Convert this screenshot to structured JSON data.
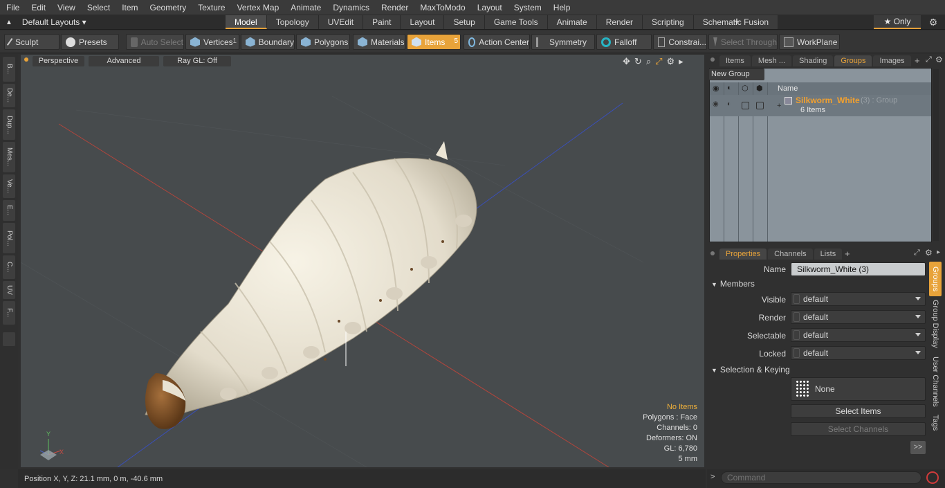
{
  "menu": [
    "File",
    "Edit",
    "View",
    "Select",
    "Item",
    "Geometry",
    "Texture",
    "Vertex Map",
    "Animate",
    "Dynamics",
    "Render",
    "MaxToModo",
    "Layout",
    "System",
    "Help"
  ],
  "layouts_label": "Default Layouts ▾",
  "mode_tabs": [
    "Model",
    "Topology",
    "UVEdit",
    "Paint",
    "Layout",
    "Setup",
    "Game Tools",
    "Animate",
    "Render",
    "Scripting",
    "Schematic Fusion"
  ],
  "active_tab": "Model",
  "only_label": "★  Only",
  "toolbar": {
    "sculpt": "Sculpt",
    "presets": "Presets",
    "auto_select": "Auto Select",
    "vertices": "Vertices",
    "vertices_count": "1",
    "boundary": "Boundary",
    "polygons": "Polygons",
    "materials": "Materials",
    "items": "Items",
    "items_count": "5",
    "action_center": "Action Center",
    "symmetry": "Symmetry",
    "falloff": "Falloff",
    "constraints": "Constrai...",
    "select_through": "Select Through",
    "workplane": "WorkPlane"
  },
  "left_tabs": [
    "B...",
    "De...",
    "Dup...",
    "Mes...",
    "Ve...",
    "E...",
    "Pol...",
    "C...",
    "UV",
    "F..."
  ],
  "viewport": {
    "perspective": "Perspective",
    "advanced": "Advanced",
    "raygl": "Ray GL: Off",
    "stats": {
      "no_items": "No Items",
      "polygons": "Polygons : Face",
      "channels": "Channels: 0",
      "deformers": "Deformers: ON",
      "gl": "GL: 6,780",
      "scale": "5 mm"
    }
  },
  "status_position": "Position X, Y, Z:   21.1 mm, 0 m, -40.6 mm",
  "right_tabs": [
    "Items",
    "Mesh ...",
    "Shading",
    "Groups",
    "Images"
  ],
  "right_active": "Groups",
  "groups": {
    "new_group": "New Group",
    "name_header": "Name",
    "group_name": "Silkworm_White",
    "group_suffix": "(3) : Group",
    "group_items": "6 Items"
  },
  "prop_tabs": [
    "Properties",
    "Channels",
    "Lists"
  ],
  "prop_active": "Properties",
  "properties": {
    "name_label": "Name",
    "name_value": "Silkworm_White (3)",
    "members": "Members",
    "visible_label": "Visible",
    "render_label": "Render",
    "selectable_label": "Selectable",
    "locked_label": "Locked",
    "default_value": "default",
    "sel_keying": "Selection & Keying",
    "none": "None",
    "select_items": "Select Items",
    "select_channels": "Select Channels",
    "more": ">>"
  },
  "side_vtabs": [
    "Groups",
    "Group Display",
    "User Channels",
    "Tags"
  ],
  "command_placeholder": "Command",
  "colors": {
    "accent": "#e8a33a",
    "viewport_bg": "#474b4d",
    "group_name": "#f0a030"
  }
}
